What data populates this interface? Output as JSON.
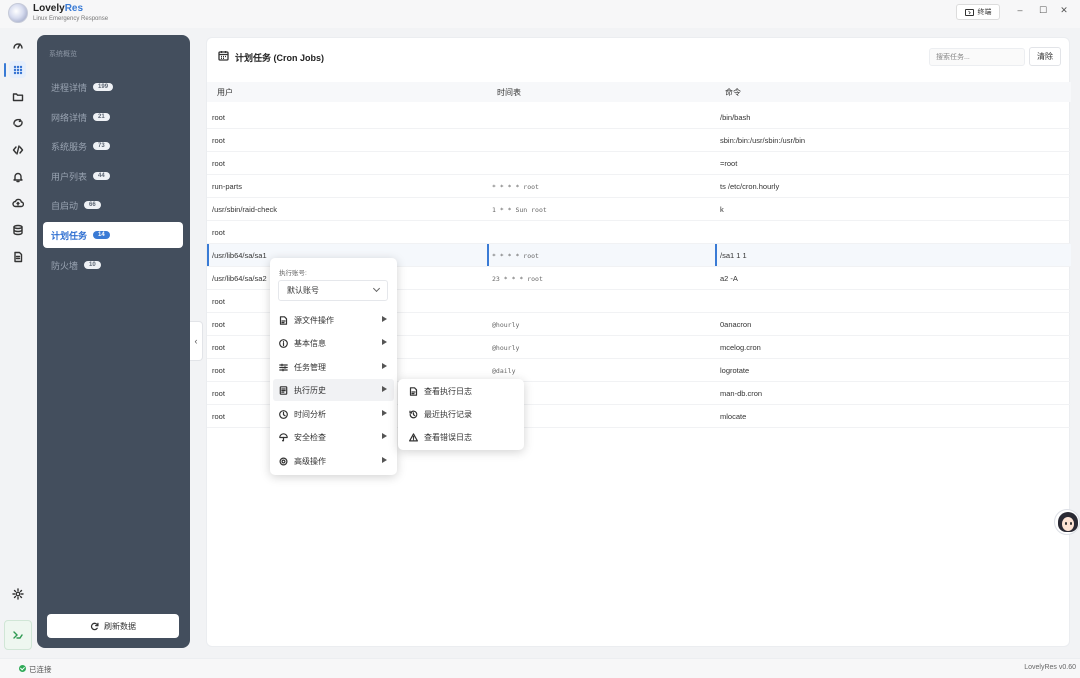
{
  "titlebar": {
    "app_name_prefix": "Lovely",
    "app_name_suffix": "Res",
    "subtitle": "Linux Emergency Response",
    "terminal_label": "终端",
    "minimize": "–",
    "maximize": "☐",
    "close": "✕"
  },
  "rail": {
    "icons": [
      "dashboard-icon",
      "grid-icon",
      "folder-icon",
      "network-icon",
      "code-icon",
      "bell-icon",
      "cloud-icon",
      "database-icon",
      "document-icon",
      "settings-icon",
      "connection-icon"
    ],
    "active": "grid-icon"
  },
  "sidebar": {
    "title": "系统概览",
    "items": [
      {
        "label": "进程详情",
        "badge": "199"
      },
      {
        "label": "网络详情",
        "badge": "21"
      },
      {
        "label": "系统服务",
        "badge": "73"
      },
      {
        "label": "用户列表",
        "badge": "44"
      },
      {
        "label": "自启动",
        "badge": "66"
      },
      {
        "label": "计划任务",
        "badge": "14"
      },
      {
        "label": "防火墙",
        "badge": "10"
      }
    ],
    "active_index": 5,
    "refresh_label": "刷新数据",
    "collapse_symbol": "‹"
  },
  "main": {
    "title": "计划任务 (Cron Jobs)",
    "search_placeholder": "搜索任务...",
    "clear_label": "清除",
    "columns": [
      "用户",
      "时间表",
      "命令"
    ],
    "rows": [
      {
        "user": "root",
        "schedule": "",
        "command": "/bin/bash"
      },
      {
        "user": "root",
        "schedule": "",
        "command": "sbin:/bin:/usr/sbin:/usr/bin"
      },
      {
        "user": "root",
        "schedule": "",
        "command": "=root"
      },
      {
        "user": "run-parts",
        "schedule": "* * * * root",
        "command": "ts /etc/cron.hourly"
      },
      {
        "user": "/usr/sbin/raid-check",
        "schedule": "1 * * Sun root",
        "command": "k"
      },
      {
        "user": "root",
        "schedule": "",
        "command": ""
      },
      {
        "user": "/usr/lib64/sa/sa1",
        "schedule": "* * * * root",
        "command": "/sa1 1 1"
      },
      {
        "user": "/usr/lib64/sa/sa2",
        "schedule": "23 * * * root",
        "command": "a2 -A"
      },
      {
        "user": "root",
        "schedule": "",
        "command": ""
      },
      {
        "user": "root",
        "schedule": "@hourly",
        "command": "0anacron"
      },
      {
        "user": "root",
        "schedule": "@hourly",
        "command": "mcelog.cron"
      },
      {
        "user": "root",
        "schedule": "@daily",
        "command": "logrotate"
      },
      {
        "user": "root",
        "schedule": "",
        "command": "man-db.cron"
      },
      {
        "user": "root",
        "schedule": "",
        "command": "mlocate"
      }
    ],
    "selected_row": 6
  },
  "context_menu": {
    "account_label": "执行账号:",
    "account_value": "默认账号",
    "items": [
      {
        "label": "源文件操作",
        "icon": "file-icon"
      },
      {
        "label": "基本信息",
        "icon": "info-icon"
      },
      {
        "label": "任务管理",
        "icon": "sliders-icon"
      },
      {
        "label": "执行历史",
        "icon": "history-icon"
      },
      {
        "label": "时间分析",
        "icon": "clock-icon"
      },
      {
        "label": "安全检查",
        "icon": "umbrella-icon"
      },
      {
        "label": "高级操作",
        "icon": "gear-icon"
      }
    ],
    "hover_index": 3,
    "submenu": [
      {
        "label": "查看执行日志",
        "icon": "log-icon"
      },
      {
        "label": "最近执行记录",
        "icon": "recent-icon"
      },
      {
        "label": "查看错误日志",
        "icon": "warning-icon"
      }
    ]
  },
  "statusbar": {
    "status": "已连接",
    "version": "LovelyRes v0.60"
  }
}
